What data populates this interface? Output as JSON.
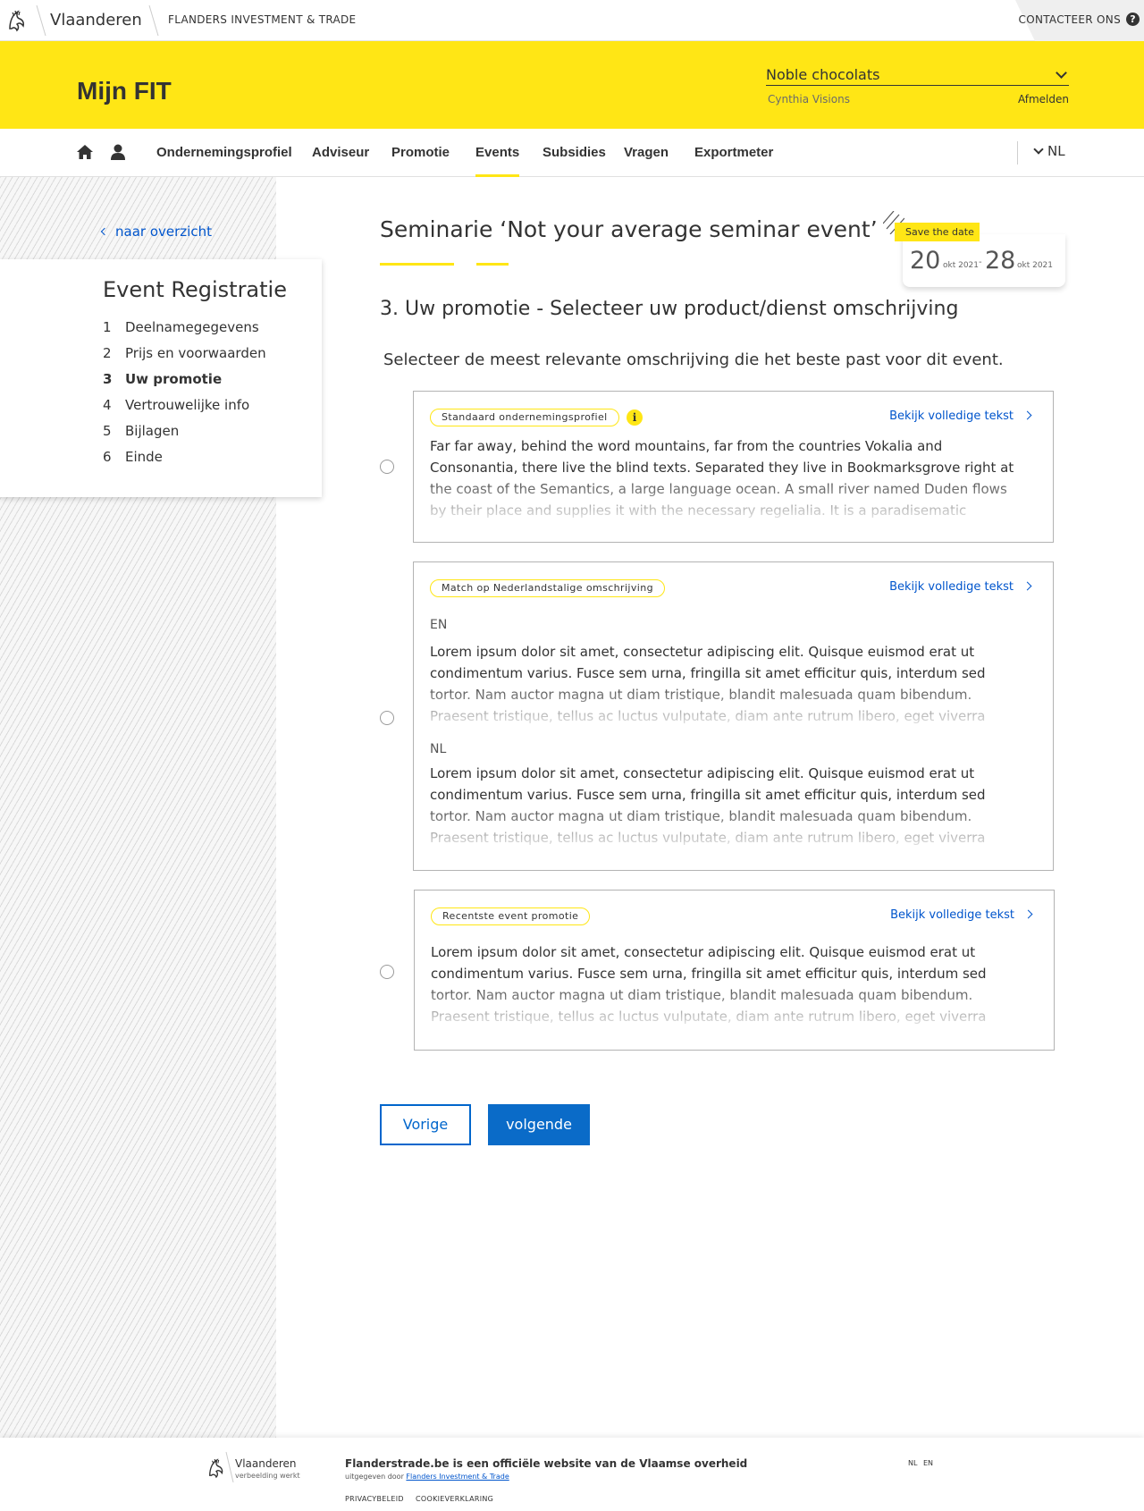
{
  "topbar": {
    "brand": "Vlaanderen",
    "subbrand": "FLANDERS INVESTMENT & TRADE",
    "contact_label": "CONTACTEER ONS",
    "help_icon": "?"
  },
  "header": {
    "site_title": "Mijn FIT",
    "company_select_value": "Noble chocolats",
    "user_name": "Cynthia Visions",
    "logout_label": "Afmelden",
    "background_color": "#ffe615"
  },
  "nav": {
    "items": [
      {
        "label": "Ondernemingsprofiel"
      },
      {
        "label": "Adviseur"
      },
      {
        "label": "Promotie"
      },
      {
        "label": "Events",
        "active": true
      },
      {
        "label": "Subsidies"
      },
      {
        "label": "Vragen"
      },
      {
        "label": "Exportmeter"
      }
    ],
    "language": "NL"
  },
  "sidebar": {
    "back_link": "naar overzicht",
    "title": "Event Registratie",
    "steps": [
      {
        "num": "1",
        "label": "Deelnamegegevens"
      },
      {
        "num": "2",
        "label": "Prijs en voorwaarden"
      },
      {
        "num": "3",
        "label": "Uw promotie",
        "current": true
      },
      {
        "num": "4",
        "label": "Vertrouwelijke info"
      },
      {
        "num": "5",
        "label": "Bijlagen"
      },
      {
        "num": "6",
        "label": "Einde"
      }
    ]
  },
  "event": {
    "title": "Seminarie ‘Not your average seminar event’",
    "save_the_date": "Save the date",
    "start_day": "20",
    "start_month": "okt 2021",
    "date_separator": "-",
    "end_day": "28",
    "end_month": "okt 2021"
  },
  "main": {
    "step_heading": "3. Uw promotie - Selecteer uw product/dienst omschrijving",
    "instruction": "Selecteer de meest relevante omschrijving die het beste past voor dit event.",
    "full_text_link": "Bekijk volledige tekst",
    "options": [
      {
        "tag": "Standaard ondernemingsprofiel",
        "info_icon": "i",
        "text": "Far far away, behind the word mountains, far from the countries Vokalia and Consonantia, there live the blind texts. Separated they live in Bookmarksgrove right at the coast of the Semantics, a large language ocean. A small river named Duden flows by their place and supplies it with the necessary regelialia. It is a paradisematic country, in which roasted parts of"
      },
      {
        "tag": "Match op Nederlandstalige omschrijving",
        "lang_en": "EN",
        "text_en": " Lorem ipsum dolor sit amet, consectetur adipiscing elit. Quisque euismod erat ut condimentum varius. Fusce sem urna, fringilla sit amet efficitur quis, interdum sed tortor. Nam auctor magna ut diam tristique, blandit malesuada quam bibendum. Praesent tristique, tellus ac luctus vulputate, diam ante rutrum libero, eget viverra tellus metus auctor elit. Duis lobortis",
        "lang_nl": "NL",
        "text_nl": " Lorem ipsum dolor sit amet, consectetur adipiscing elit. Quisque euismod erat ut condimentum varius. Fusce sem urna, fringilla sit amet efficitur quis, interdum sed tortor. Nam auctor magna ut diam tristique, blandit malesuada quam bibendum. Praesent tristique, tellus ac luctus vulputate, diam ante rutrum libero, eget viverra tellus metus auctor elit. Duis lobortis"
      },
      {
        "tag": "Recentste event promotie",
        "text": " Lorem ipsum dolor sit amet, consectetur adipiscing elit. Quisque euismod erat ut condimentum varius. Fusce sem urna, fringilla sit amet efficitur quis, interdum sed tortor. Nam auctor magna ut diam tristique, blandit malesuada quam bibendum. Praesent tristique, tellus ac luctus vulputate, diam ante rutrum libero, eget viverra tellus metus auctor elit. Duis lobortis"
      }
    ],
    "prev_label": "Vorige",
    "next_label": "volgende"
  },
  "footer": {
    "brand": "Vlaanderen",
    "brand_sub": "verbeelding werkt",
    "title": "Flanderstrade.be is een officiële website van de Vlaamse overheid",
    "published_by": "uitgegeven door",
    "publisher_link": "Flanders Investment & Trade",
    "privacy": "PRIVACYBELEID",
    "cookies": "COOKIEVERKLARING",
    "lang_nl": "NL",
    "lang_en": "EN"
  }
}
